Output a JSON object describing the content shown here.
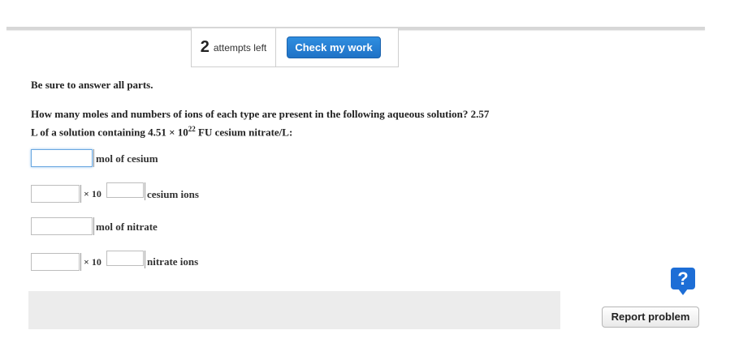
{
  "header": {
    "attempts_count": "2",
    "attempts_label": "attempts left",
    "check_button": "Check my work"
  },
  "instructions": "Be sure to answer all parts.",
  "question": {
    "text_line1": "How many moles and numbers of ions of each type are present in the following aqueous solution? 2.57",
    "text_line2_pre": "L of a solution containing 4.51 × 10",
    "exponent": "22",
    "text_line2_post": " FU cesium nitrate/L:"
  },
  "answers": {
    "mol_cesium_label": "mol of cesium",
    "times_ten": "× 10",
    "cesium_ions_label": "cesium ions",
    "mol_nitrate_label": "mol of nitrate",
    "nitrate_ions_label": "nitrate ions",
    "mol_cesium_value": "",
    "cesium_mantissa_value": "",
    "cesium_exponent_value": "",
    "mol_nitrate_value": "",
    "nitrate_mantissa_value": "",
    "nitrate_exponent_value": ""
  },
  "footer": {
    "help_icon": "?",
    "report_button": "Report problem"
  },
  "colors": {
    "accent_blue": "#1f72c6",
    "help_blue": "#1d6ed6",
    "footer_gray": "#ececec"
  }
}
